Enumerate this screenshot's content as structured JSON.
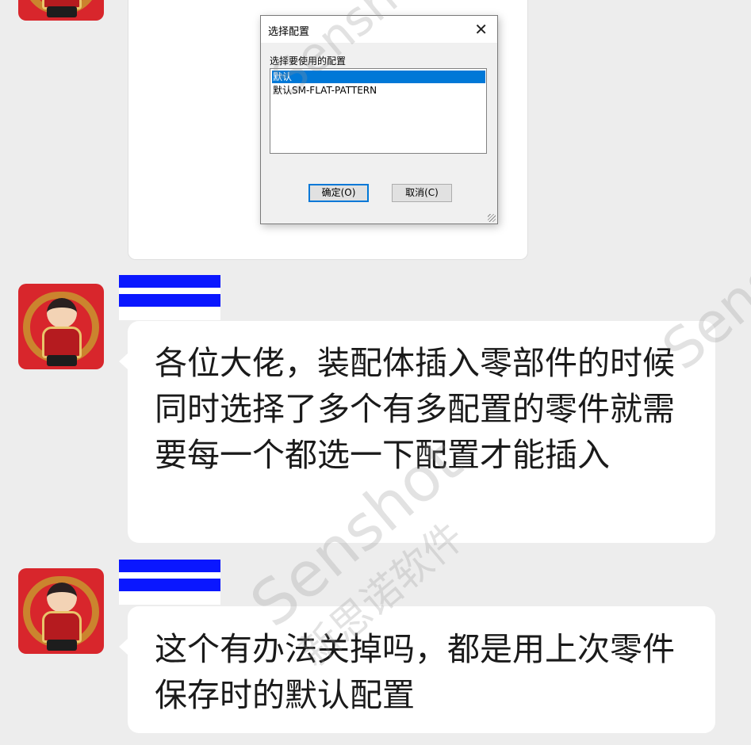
{
  "dialog": {
    "title": "选择配置",
    "close_glyph": "✕",
    "prompt": "选择要使用的配置",
    "options": [
      "默认",
      "默认SM-FLAT-PATTERN"
    ],
    "selected": "默认",
    "ok_label": "确定(O)",
    "cancel_label": "取消(C)"
  },
  "messages": [
    {
      "text": "各位大佬，装配体插入零部件的时候同时选择了多个有多配置的零件就需要每一个都选一下配置才能插入"
    },
    {
      "text": "这个有办法关掉吗，都是用上次零件保存时的默认配置"
    }
  ],
  "watermark": {
    "brand": "Senshot",
    "brand_cn": "新思诺软件"
  },
  "colors": {
    "background": "#ededed",
    "bubble": "#ffffff",
    "name_redaction": "#0a17ff",
    "selection": "#0078d7"
  }
}
